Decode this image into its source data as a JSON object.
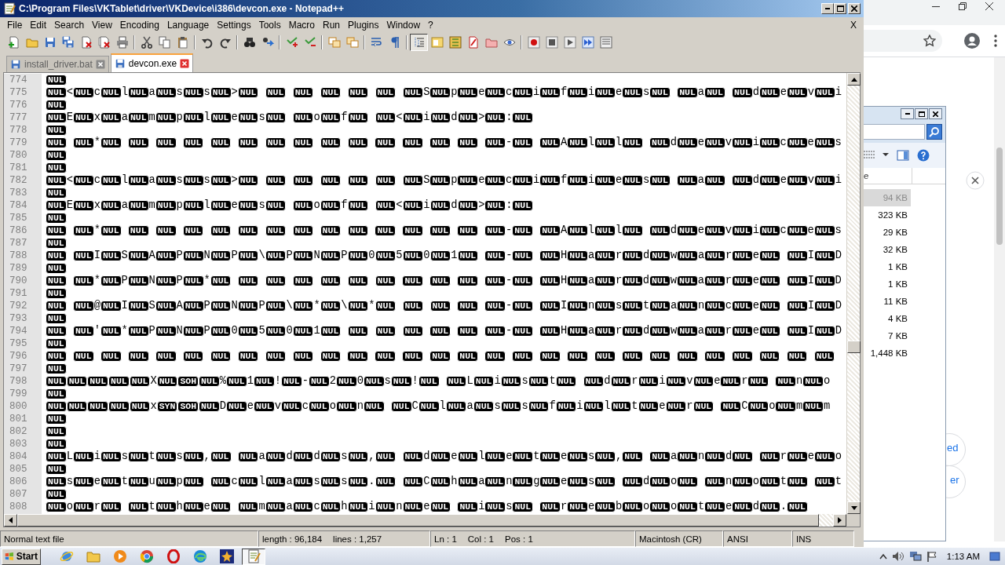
{
  "window": {
    "title": "C:\\Program Files\\VKTablet\\driver\\VKDevice\\i386\\devcon.exe - Notepad++",
    "menu": [
      "File",
      "Edit",
      "Search",
      "View",
      "Encoding",
      "Language",
      "Settings",
      "Tools",
      "Macro",
      "Run",
      "Plugins",
      "Window",
      "?"
    ],
    "menu_close": "X"
  },
  "toolbar": [
    {
      "pressed": false
    },
    {
      "pressed": false
    },
    {
      "pressed": false
    },
    {
      "pressed": false
    },
    {
      "pressed": false
    },
    {
      "pressed": false
    },
    {
      "pressed": false
    },
    {
      "pressed": false
    },
    {
      "pressed": false
    },
    {
      "pressed": false
    },
    {
      "pressed": false
    },
    {
      "pressed": false
    },
    {
      "pressed": false
    },
    {
      "pressed": false
    },
    {
      "pressed": false
    },
    {
      "pressed": false
    },
    {
      "pressed": false
    },
    {
      "pressed": false
    },
    {
      "pressed": false
    },
    {
      "pressed": false
    },
    {
      "pressed": true
    },
    {
      "pressed": false
    },
    {
      "pressed": false
    },
    {
      "pressed": false
    },
    {
      "pressed": false
    },
    {
      "pressed": false
    },
    {
      "pressed": false
    },
    {
      "pressed": false
    },
    {
      "pressed": false
    },
    {
      "pressed": false
    },
    {
      "pressed": false
    }
  ],
  "tabs": [
    {
      "label": "install_driver.bat",
      "selected": false
    },
    {
      "label": "devcon.exe",
      "selected": true
    }
  ],
  "editor": {
    "lines": [
      {
        "number": "774",
        "segments": [
          [
            "NUL"
          ]
        ]
      },
      {
        "number": "775",
        "segments": [
          [
            "NUL"
          ],
          "<",
          [
            "NUL"
          ],
          "c",
          [
            "NUL"
          ],
          "l",
          [
            "NUL"
          ],
          "a",
          [
            "NUL"
          ],
          "s",
          [
            "NUL"
          ],
          "s",
          [
            "NUL"
          ],
          ">",
          [
            "NUL",
            true
          ],
          [
            "NUL",
            true
          ],
          [
            "NUL",
            true
          ],
          [
            "NUL",
            true
          ],
          [
            "NUL",
            true
          ],
          [
            "NUL",
            true
          ],
          [
            "NUL"
          ],
          "S",
          [
            "NUL"
          ],
          "p",
          [
            "NUL"
          ],
          "e",
          [
            "NUL"
          ],
          "c",
          [
            "NUL"
          ],
          "i",
          [
            "NUL"
          ],
          "f",
          [
            "NUL"
          ],
          "i",
          [
            "NUL"
          ],
          "e",
          [
            "NUL"
          ],
          "s",
          [
            "NUL",
            true
          ],
          [
            "NUL"
          ],
          "a",
          [
            "NUL",
            true
          ],
          [
            "NUL"
          ],
          "d",
          [
            "NUL"
          ],
          "e",
          [
            "NUL"
          ],
          "v",
          [
            "NUL"
          ],
          "i"
        ]
      },
      {
        "number": "776",
        "segments": [
          [
            "NUL"
          ]
        ]
      },
      {
        "number": "777",
        "segments": [
          [
            "NUL"
          ],
          "E",
          [
            "NUL"
          ],
          "x",
          [
            "NUL"
          ],
          "a",
          [
            "NUL"
          ],
          "m",
          [
            "NUL"
          ],
          "p",
          [
            "NUL"
          ],
          "l",
          [
            "NUL"
          ],
          "e",
          [
            "NUL"
          ],
          "s",
          [
            "NUL",
            true
          ],
          [
            "NUL"
          ],
          "o",
          [
            "NUL"
          ],
          "f",
          [
            "NUL",
            true
          ],
          [
            "NUL"
          ],
          "<",
          [
            "NUL"
          ],
          "i",
          [
            "NUL"
          ],
          "d",
          [
            "NUL"
          ],
          ">",
          [
            "NUL"
          ],
          ":",
          [
            "NUL"
          ]
        ]
      },
      {
        "number": "778",
        "segments": [
          [
            "NUL"
          ]
        ]
      },
      {
        "number": "779",
        "segments": [
          [
            "NUL",
            true
          ],
          [
            "NUL"
          ],
          "*",
          [
            "NUL",
            true
          ],
          [
            "NUL",
            true
          ],
          [
            "NUL",
            true
          ],
          [
            "NUL",
            true
          ],
          [
            "NUL",
            true
          ],
          [
            "NUL",
            true
          ],
          [
            "NUL",
            true
          ],
          [
            "NUL",
            true
          ],
          [
            "NUL",
            true
          ],
          [
            "NUL",
            true
          ],
          [
            "NUL",
            true
          ],
          [
            "NUL",
            true
          ],
          [
            "NUL",
            true
          ],
          [
            "NUL",
            true
          ],
          [
            "NUL"
          ],
          "-",
          [
            "NUL",
            true
          ],
          [
            "NUL"
          ],
          "A",
          [
            "NUL"
          ],
          "l",
          [
            "NUL"
          ],
          "l",
          [
            "NUL",
            true
          ],
          [
            "NUL"
          ],
          "d",
          [
            "NUL"
          ],
          "e",
          [
            "NUL"
          ],
          "v",
          [
            "NUL"
          ],
          "i",
          [
            "NUL"
          ],
          "c",
          [
            "NUL"
          ],
          "e",
          [
            "NUL"
          ],
          "s"
        ]
      },
      {
        "number": "780",
        "segments": [
          [
            "NUL"
          ]
        ]
      },
      {
        "number": "781",
        "segments": [
          [
            "NUL"
          ]
        ]
      },
      {
        "number": "782",
        "segments": [
          [
            "NUL"
          ],
          "<",
          [
            "NUL"
          ],
          "c",
          [
            "NUL"
          ],
          "l",
          [
            "NUL"
          ],
          "a",
          [
            "NUL"
          ],
          "s",
          [
            "NUL"
          ],
          "s",
          [
            "NUL"
          ],
          ">",
          [
            "NUL",
            true
          ],
          [
            "NUL",
            true
          ],
          [
            "NUL",
            true
          ],
          [
            "NUL",
            true
          ],
          [
            "NUL",
            true
          ],
          [
            "NUL",
            true
          ],
          [
            "NUL"
          ],
          "S",
          [
            "NUL"
          ],
          "p",
          [
            "NUL"
          ],
          "e",
          [
            "NUL"
          ],
          "c",
          [
            "NUL"
          ],
          "i",
          [
            "NUL"
          ],
          "f",
          [
            "NUL"
          ],
          "i",
          [
            "NUL"
          ],
          "e",
          [
            "NUL"
          ],
          "s",
          [
            "NUL",
            true
          ],
          [
            "NUL"
          ],
          "a",
          [
            "NUL",
            true
          ],
          [
            "NUL"
          ],
          "d",
          [
            "NUL"
          ],
          "e",
          [
            "NUL"
          ],
          "v",
          [
            "NUL"
          ],
          "i"
        ]
      },
      {
        "number": "783",
        "segments": [
          [
            "NUL"
          ]
        ]
      },
      {
        "number": "784",
        "segments": [
          [
            "NUL"
          ],
          "E",
          [
            "NUL"
          ],
          "x",
          [
            "NUL"
          ],
          "a",
          [
            "NUL"
          ],
          "m",
          [
            "NUL"
          ],
          "p",
          [
            "NUL"
          ],
          "l",
          [
            "NUL"
          ],
          "e",
          [
            "NUL"
          ],
          "s",
          [
            "NUL",
            true
          ],
          [
            "NUL"
          ],
          "o",
          [
            "NUL"
          ],
          "f",
          [
            "NUL",
            true
          ],
          [
            "NUL"
          ],
          "<",
          [
            "NUL"
          ],
          "i",
          [
            "NUL"
          ],
          "d",
          [
            "NUL"
          ],
          ">",
          [
            "NUL"
          ],
          ":",
          [
            "NUL"
          ]
        ]
      },
      {
        "number": "785",
        "segments": [
          [
            "NUL"
          ]
        ]
      },
      {
        "number": "786",
        "segments": [
          [
            "NUL",
            true
          ],
          [
            "NUL"
          ],
          "*",
          [
            "NUL",
            true
          ],
          [
            "NUL",
            true
          ],
          [
            "NUL",
            true
          ],
          [
            "NUL",
            true
          ],
          [
            "NUL",
            true
          ],
          [
            "NUL",
            true
          ],
          [
            "NUL",
            true
          ],
          [
            "NUL",
            true
          ],
          [
            "NUL",
            true
          ],
          [
            "NUL",
            true
          ],
          [
            "NUL",
            true
          ],
          [
            "NUL",
            true
          ],
          [
            "NUL",
            true
          ],
          [
            "NUL",
            true
          ],
          [
            "NUL"
          ],
          "-",
          [
            "NUL",
            true
          ],
          [
            "NUL"
          ],
          "A",
          [
            "NUL"
          ],
          "l",
          [
            "NUL"
          ],
          "l",
          [
            "NUL",
            true
          ],
          [
            "NUL"
          ],
          "d",
          [
            "NUL"
          ],
          "e",
          [
            "NUL"
          ],
          "v",
          [
            "NUL"
          ],
          "i",
          [
            "NUL"
          ],
          "c",
          [
            "NUL"
          ],
          "e",
          [
            "NUL"
          ],
          "s"
        ]
      },
      {
        "number": "787",
        "segments": [
          [
            "NUL"
          ]
        ]
      },
      {
        "number": "788",
        "segments": [
          [
            "NUL",
            true
          ],
          [
            "NUL"
          ],
          "I",
          [
            "NUL"
          ],
          "S",
          [
            "NUL"
          ],
          "A",
          [
            "NUL"
          ],
          "P",
          [
            "NUL"
          ],
          "N",
          [
            "NUL"
          ],
          "P",
          [
            "NUL"
          ],
          "\\",
          [
            "NUL"
          ],
          "P",
          [
            "NUL"
          ],
          "N",
          [
            "NUL"
          ],
          "P",
          [
            "NUL"
          ],
          "0",
          [
            "NUL"
          ],
          "5",
          [
            "NUL"
          ],
          "0",
          [
            "NUL"
          ],
          "1",
          [
            "NUL",
            true
          ],
          [
            "NUL"
          ],
          "-",
          [
            "NUL",
            true
          ],
          [
            "NUL"
          ],
          "H",
          [
            "NUL"
          ],
          "a",
          [
            "NUL"
          ],
          "r",
          [
            "NUL"
          ],
          "d",
          [
            "NUL"
          ],
          "w",
          [
            "NUL"
          ],
          "a",
          [
            "NUL"
          ],
          "r",
          [
            "NUL"
          ],
          "e",
          [
            "NUL",
            true
          ],
          [
            "NUL"
          ],
          "I",
          [
            "NUL"
          ],
          "D"
        ]
      },
      {
        "number": "789",
        "segments": [
          [
            "NUL"
          ]
        ]
      },
      {
        "number": "790",
        "segments": [
          [
            "NUL",
            true
          ],
          [
            "NUL"
          ],
          "*",
          [
            "NUL"
          ],
          "P",
          [
            "NUL"
          ],
          "N",
          [
            "NUL"
          ],
          "P",
          [
            "NUL"
          ],
          "*",
          [
            "NUL",
            true
          ],
          [
            "NUL",
            true
          ],
          [
            "NUL",
            true
          ],
          [
            "NUL",
            true
          ],
          [
            "NUL",
            true
          ],
          [
            "NUL",
            true
          ],
          [
            "NUL",
            true
          ],
          [
            "NUL",
            true
          ],
          [
            "NUL",
            true
          ],
          [
            "NUL",
            true
          ],
          [
            "NUL"
          ],
          "-",
          [
            "NUL",
            true
          ],
          [
            "NUL"
          ],
          "H",
          [
            "NUL"
          ],
          "a",
          [
            "NUL"
          ],
          "r",
          [
            "NUL"
          ],
          "d",
          [
            "NUL"
          ],
          "w",
          [
            "NUL"
          ],
          "a",
          [
            "NUL"
          ],
          "r",
          [
            "NUL"
          ],
          "e",
          [
            "NUL",
            true
          ],
          [
            "NUL"
          ],
          "I",
          [
            "NUL"
          ],
          "D"
        ]
      },
      {
        "number": "791",
        "segments": [
          [
            "NUL"
          ]
        ]
      },
      {
        "number": "792",
        "segments": [
          [
            "NUL",
            true
          ],
          [
            "NUL"
          ],
          "@",
          [
            "NUL"
          ],
          "I",
          [
            "NUL"
          ],
          "S",
          [
            "NUL"
          ],
          "A",
          [
            "NUL"
          ],
          "P",
          [
            "NUL"
          ],
          "N",
          [
            "NUL"
          ],
          "P",
          [
            "NUL"
          ],
          "\\",
          [
            "NUL"
          ],
          "*",
          [
            "NUL"
          ],
          "\\",
          [
            "NUL"
          ],
          "*",
          [
            "NUL",
            true
          ],
          [
            "NUL",
            true
          ],
          [
            "NUL",
            true
          ],
          [
            "NUL",
            true
          ],
          [
            "NUL"
          ],
          "-",
          [
            "NUL",
            true
          ],
          [
            "NUL"
          ],
          "I",
          [
            "NUL"
          ],
          "n",
          [
            "NUL"
          ],
          "s",
          [
            "NUL"
          ],
          "t",
          [
            "NUL"
          ],
          "a",
          [
            "NUL"
          ],
          "n",
          [
            "NUL"
          ],
          "c",
          [
            "NUL"
          ],
          "e",
          [
            "NUL",
            true
          ],
          [
            "NUL"
          ],
          "I",
          [
            "NUL"
          ],
          "D"
        ]
      },
      {
        "number": "793",
        "segments": [
          [
            "NUL"
          ]
        ]
      },
      {
        "number": "794",
        "segments": [
          [
            "NUL",
            true
          ],
          [
            "NUL"
          ],
          "'",
          [
            "NUL"
          ],
          "*",
          [
            "NUL"
          ],
          "P",
          [
            "NUL"
          ],
          "N",
          [
            "NUL"
          ],
          "P",
          [
            "NUL"
          ],
          "0",
          [
            "NUL"
          ],
          "5",
          [
            "NUL"
          ],
          "0",
          [
            "NUL"
          ],
          "1",
          [
            "NUL",
            true
          ],
          [
            "NUL",
            true
          ],
          [
            "NUL",
            true
          ],
          [
            "NUL",
            true
          ],
          [
            "NUL",
            true
          ],
          [
            "NUL",
            true
          ],
          [
            "NUL"
          ],
          "-",
          [
            "NUL",
            true
          ],
          [
            "NUL"
          ],
          "H",
          [
            "NUL"
          ],
          "a",
          [
            "NUL"
          ],
          "r",
          [
            "NUL"
          ],
          "d",
          [
            "NUL"
          ],
          "w",
          [
            "NUL"
          ],
          "a",
          [
            "NUL"
          ],
          "r",
          [
            "NUL"
          ],
          "e",
          [
            "NUL",
            true
          ],
          [
            "NUL"
          ],
          "I",
          [
            "NUL"
          ],
          "D"
        ]
      },
      {
        "number": "795",
        "segments": [
          [
            "NUL"
          ]
        ]
      },
      {
        "number": "796",
        "segments": [
          [
            "NUL",
            true
          ],
          [
            "NUL",
            true
          ],
          [
            "NUL",
            true
          ],
          [
            "NUL",
            true
          ],
          [
            "NUL",
            true
          ],
          [
            "NUL",
            true
          ],
          [
            "NUL",
            true
          ],
          [
            "NUL",
            true
          ],
          [
            "NUL",
            true
          ],
          [
            "NUL",
            true
          ],
          [
            "NUL",
            true
          ],
          [
            "NUL",
            true
          ],
          [
            "NUL",
            true
          ],
          [
            "NUL",
            true
          ],
          [
            "NUL",
            true
          ],
          [
            "NUL",
            true
          ],
          [
            "NUL",
            true
          ],
          [
            "NUL",
            true
          ],
          [
            "NUL",
            true
          ],
          [
            "NUL",
            true
          ],
          [
            "NUL",
            true
          ],
          [
            "NUL",
            true
          ],
          [
            "NUL",
            true
          ],
          [
            "NUL",
            true
          ],
          [
            "NUL",
            true
          ],
          [
            "NUL",
            true
          ],
          [
            "NUL",
            true
          ],
          [
            "NUL",
            true
          ],
          [
            "NUL",
            true
          ]
        ]
      },
      {
        "number": "797",
        "segments": [
          [
            "NUL"
          ]
        ]
      },
      {
        "number": "798",
        "segments": [
          [
            "NUL"
          ],
          [
            "NUL"
          ],
          [
            "NUL"
          ],
          [
            "NUL"
          ],
          [
            "NUL"
          ],
          "X",
          [
            "NUL"
          ],
          [
            "SOH"
          ],
          [
            "NUL"
          ],
          "%",
          [
            "NUL"
          ],
          "1",
          [
            "NUL"
          ],
          "!",
          [
            "NUL"
          ],
          "-",
          [
            "NUL"
          ],
          "2",
          [
            "NUL"
          ],
          "0",
          [
            "NUL"
          ],
          "s",
          [
            "NUL"
          ],
          "!",
          [
            "NUL",
            true
          ],
          [
            "NUL"
          ],
          "L",
          [
            "NUL"
          ],
          "i",
          [
            "NUL"
          ],
          "s",
          [
            "NUL"
          ],
          "t",
          [
            "NUL",
            true
          ],
          [
            "NUL"
          ],
          "d",
          [
            "NUL"
          ],
          "r",
          [
            "NUL"
          ],
          "i",
          [
            "NUL"
          ],
          "v",
          [
            "NUL"
          ],
          "e",
          [
            "NUL"
          ],
          "r",
          [
            "NUL",
            true
          ],
          [
            "NUL"
          ],
          "n",
          [
            "NUL"
          ],
          "o"
        ]
      },
      {
        "number": "799",
        "segments": [
          [
            "NUL"
          ]
        ]
      },
      {
        "number": "800",
        "segments": [
          [
            "NUL"
          ],
          [
            "NUL"
          ],
          [
            "NUL"
          ],
          [
            "NUL"
          ],
          [
            "NUL"
          ],
          "x",
          [
            "SYN"
          ],
          [
            "SOH"
          ],
          [
            "NUL"
          ],
          "D",
          [
            "NUL"
          ],
          "e",
          [
            "NUL"
          ],
          "v",
          [
            "NUL"
          ],
          "c",
          [
            "NUL"
          ],
          "o",
          [
            "NUL"
          ],
          "n",
          [
            "NUL",
            true
          ],
          [
            "NUL"
          ],
          "C",
          [
            "NUL"
          ],
          "l",
          [
            "NUL"
          ],
          "a",
          [
            "NUL"
          ],
          "s",
          [
            "NUL"
          ],
          "s",
          [
            "NUL"
          ],
          "f",
          [
            "NUL"
          ],
          "i",
          [
            "NUL"
          ],
          "l",
          [
            "NUL"
          ],
          "t",
          [
            "NUL"
          ],
          "e",
          [
            "NUL"
          ],
          "r",
          [
            "NUL",
            true
          ],
          [
            "NUL"
          ],
          "C",
          [
            "NUL"
          ],
          "o",
          [
            "NUL"
          ],
          "m",
          [
            "NUL"
          ],
          "m"
        ]
      },
      {
        "number": "801",
        "segments": [
          [
            "NUL"
          ]
        ]
      },
      {
        "number": "802",
        "segments": [
          [
            "NUL"
          ]
        ]
      },
      {
        "number": "803",
        "segments": [
          [
            "NUL"
          ]
        ]
      },
      {
        "number": "804",
        "segments": [
          [
            "NUL"
          ],
          "L",
          [
            "NUL"
          ],
          "i",
          [
            "NUL"
          ],
          "s",
          [
            "NUL"
          ],
          "t",
          [
            "NUL"
          ],
          "s",
          [
            "NUL"
          ],
          ",",
          [
            "NUL",
            true
          ],
          [
            "NUL"
          ],
          "a",
          [
            "NUL"
          ],
          "d",
          [
            "NUL"
          ],
          "d",
          [
            "NUL"
          ],
          "s",
          [
            "NUL"
          ],
          ",",
          [
            "NUL",
            true
          ],
          [
            "NUL"
          ],
          "d",
          [
            "NUL"
          ],
          "e",
          [
            "NUL"
          ],
          "l",
          [
            "NUL"
          ],
          "e",
          [
            "NUL"
          ],
          "t",
          [
            "NUL"
          ],
          "e",
          [
            "NUL"
          ],
          "s",
          [
            "NUL"
          ],
          ",",
          [
            "NUL",
            true
          ],
          [
            "NUL"
          ],
          "a",
          [
            "NUL"
          ],
          "n",
          [
            "NUL"
          ],
          "d",
          [
            "NUL",
            true
          ],
          [
            "NUL"
          ],
          "r",
          [
            "NUL"
          ],
          "e",
          [
            "NUL"
          ],
          "o"
        ]
      },
      {
        "number": "805",
        "segments": [
          [
            "NUL"
          ]
        ]
      },
      {
        "number": "806",
        "segments": [
          [
            "NUL"
          ],
          "s",
          [
            "NUL"
          ],
          "e",
          [
            "NUL"
          ],
          "t",
          [
            "NUL"
          ],
          "u",
          [
            "NUL"
          ],
          "p",
          [
            "NUL",
            true
          ],
          [
            "NUL"
          ],
          "c",
          [
            "NUL"
          ],
          "l",
          [
            "NUL"
          ],
          "a",
          [
            "NUL"
          ],
          "s",
          [
            "NUL"
          ],
          "s",
          [
            "NUL"
          ],
          ".",
          [
            "NUL",
            true
          ],
          [
            "NUL"
          ],
          "C",
          [
            "NUL"
          ],
          "h",
          [
            "NUL"
          ],
          "a",
          [
            "NUL"
          ],
          "n",
          [
            "NUL"
          ],
          "g",
          [
            "NUL"
          ],
          "e",
          [
            "NUL"
          ],
          "s",
          [
            "NUL",
            true
          ],
          [
            "NUL"
          ],
          "d",
          [
            "NUL"
          ],
          "o",
          [
            "NUL",
            true
          ],
          [
            "NUL"
          ],
          "n",
          [
            "NUL"
          ],
          "o",
          [
            "NUL"
          ],
          "t",
          [
            "NUL",
            true
          ],
          [
            "NUL"
          ],
          "t"
        ]
      },
      {
        "number": "807",
        "segments": [
          [
            "NUL"
          ]
        ]
      },
      {
        "number": "808",
        "segments": [
          [
            "NUL"
          ],
          "o",
          [
            "NUL"
          ],
          "r",
          [
            "NUL",
            true
          ],
          [
            "NUL"
          ],
          "t",
          [
            "NUL"
          ],
          "h",
          [
            "NUL"
          ],
          "e",
          [
            "NUL",
            true
          ],
          [
            "NUL"
          ],
          "m",
          [
            "NUL"
          ],
          "a",
          [
            "NUL"
          ],
          "c",
          [
            "NUL"
          ],
          "h",
          [
            "NUL"
          ],
          "i",
          [
            "NUL"
          ],
          "n",
          [
            "NUL"
          ],
          "e",
          [
            "NUL",
            true
          ],
          [
            "NUL"
          ],
          "i",
          [
            "NUL"
          ],
          "s",
          [
            "NUL",
            true
          ],
          [
            "NUL"
          ],
          "r",
          [
            "NUL"
          ],
          "e",
          [
            "NUL"
          ],
          "b",
          [
            "NUL"
          ],
          "o",
          [
            "NUL"
          ],
          "o",
          [
            "NUL"
          ],
          "t",
          [
            "NUL"
          ],
          "e",
          [
            "NUL"
          ],
          "d",
          [
            "NUL"
          ],
          ".",
          [
            "NUL"
          ]
        ]
      }
    ]
  },
  "status_bar": {
    "file_type": "Normal text file",
    "length": "length : 96,184",
    "lines": "lines : 1,257",
    "line": "Ln : 1",
    "column": "Col : 1",
    "position": "Pos : 1",
    "eol": "Macintosh (CR)",
    "encoding": "ANSI",
    "mode": "INS"
  },
  "explorer": {
    "column_1": "e",
    "sizes": [
      {
        "text": "94 KB",
        "selected": true
      },
      {
        "text": "323 KB",
        "selected": false
      },
      {
        "text": "29 KB",
        "selected": false
      },
      {
        "text": "32 KB",
        "selected": false
      },
      {
        "text": "1 KB",
        "selected": false
      },
      {
        "text": "1 KB",
        "selected": false
      },
      {
        "text": "11 KB",
        "selected": false
      },
      {
        "text": "4 KB",
        "selected": false
      },
      {
        "text": "7 KB",
        "selected": false
      },
      {
        "text": "1,448 KB",
        "selected": false
      }
    ]
  },
  "browser": {
    "links": [
      "ed",
      "er"
    ]
  },
  "taskbar": {
    "start": "Start",
    "clock": "1:13 AM",
    "apps": [
      {
        "active": false
      },
      {
        "active": false
      },
      {
        "active": false
      },
      {
        "active": false
      },
      {
        "active": false
      },
      {
        "active": false
      },
      {
        "active": false
      },
      {
        "active": true
      }
    ]
  }
}
